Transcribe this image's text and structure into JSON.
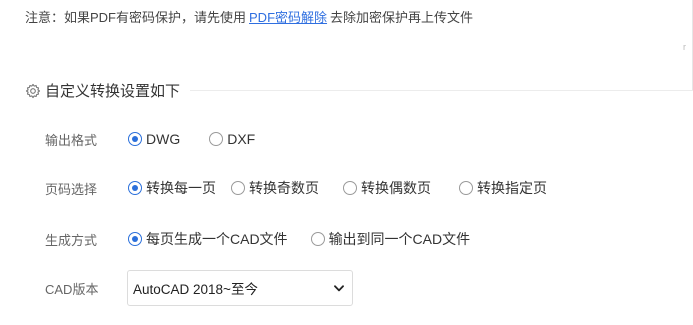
{
  "notice": {
    "prefix": "注意：如果PDF有密码保护，请先使用",
    "link": "PDF密码解除",
    "suffix": "去除加密保护再上传文件"
  },
  "edge_mark": "r",
  "settings": {
    "title": "自定义转换设置如下",
    "title_icon": "gear-icon",
    "output_format": {
      "label": "输出格式",
      "options": [
        "DWG",
        "DXF"
      ],
      "selected": "DWG"
    },
    "page_selection": {
      "label": "页码选择",
      "options": [
        "转换每一页",
        "转换奇数页",
        "转换偶数页",
        "转换指定页"
      ],
      "selected": "转换每一页"
    },
    "generation_mode": {
      "label": "生成方式",
      "options": [
        "每页生成一个CAD文件",
        "输出到同一个CAD文件"
      ],
      "selected": "每页生成一个CAD文件"
    },
    "cad_version": {
      "label": "CAD版本",
      "value": "AutoCAD 2018~至今"
    }
  },
  "colors": {
    "accent": "#2a6fdb",
    "link": "#2f6fe0",
    "label": "#666666"
  }
}
